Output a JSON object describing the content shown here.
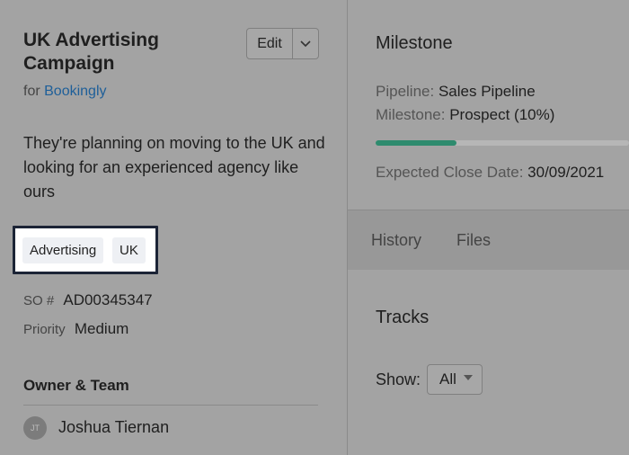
{
  "deal": {
    "title": "UK Advertising Campaign",
    "for_prefix": "for",
    "company": "Bookingly",
    "edit_label": "Edit",
    "description": "They're planning on moving to the UK and looking for an experienced agency like ours",
    "tags": [
      "Advertising",
      "UK"
    ],
    "so_label": "SO #",
    "so_value": "AD00345347",
    "priority_label": "Priority",
    "priority_value": "Medium",
    "owner_section": "Owner & Team",
    "owner_initials": "JT",
    "owner_name": "Joshua Tiernan"
  },
  "milestone": {
    "title": "Milestone",
    "pipeline_label": "Pipeline:",
    "pipeline_value": "Sales Pipeline",
    "milestone_label": "Milestone:",
    "milestone_value": "Prospect (10%)",
    "progress_fraction": 0.1,
    "close_label": "Expected Close Date:",
    "close_value": "30/09/2021"
  },
  "tabs": [
    "History",
    "Files"
  ],
  "tracks": {
    "title": "Tracks",
    "show_label": "Show:",
    "show_value": "All"
  },
  "colors": {
    "highlight_border": "#1c2436",
    "progress_fill": "#2e8b6e",
    "link": "#1e5f99"
  }
}
